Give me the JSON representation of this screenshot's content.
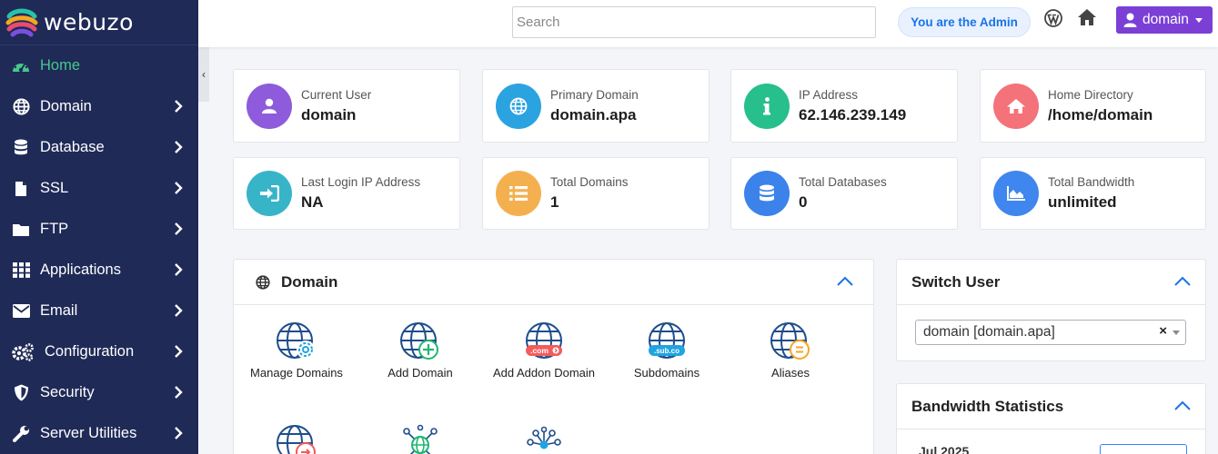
{
  "brand": {
    "name": "webuzo"
  },
  "sidebar": {
    "items": [
      {
        "label": "Home",
        "icon": "dashboard-icon",
        "active": true
      },
      {
        "label": "Domain",
        "icon": "globe-icon"
      },
      {
        "label": "Database",
        "icon": "database-icon"
      },
      {
        "label": "SSL",
        "icon": "file-icon"
      },
      {
        "label": "FTP",
        "icon": "folder-icon"
      },
      {
        "label": "Applications",
        "icon": "grid-icon"
      },
      {
        "label": "Email",
        "icon": "envelope-icon"
      },
      {
        "label": "Configuration",
        "icon": "gears-icon"
      },
      {
        "label": "Security",
        "icon": "shield-icon"
      },
      {
        "label": "Server Utilities",
        "icon": "wrench-icon"
      }
    ],
    "collapse_glyph": "‹"
  },
  "header": {
    "search_placeholder": "Search",
    "admin_badge": "You are the Admin",
    "user_menu": "domain"
  },
  "stats": [
    {
      "label": "Current User",
      "value": "domain",
      "icon": "user-icon",
      "color": "#8e5bdc"
    },
    {
      "label": "Primary Domain",
      "value": "domain.apa",
      "icon": "globe-icon",
      "color": "#2ba3e0"
    },
    {
      "label": "IP Address",
      "value": "62.146.239.149",
      "icon": "info-icon",
      "color": "#27bf8c"
    },
    {
      "label": "Home Directory",
      "value": "/home/domain",
      "icon": "home-icon",
      "color": "#f47279"
    },
    {
      "label": "Last Login IP Address",
      "value": "NA",
      "icon": "sign-in-icon",
      "color": "#38b4c8"
    },
    {
      "label": "Total Domains",
      "value": "1",
      "icon": "list-icon",
      "color": "#f4b04f"
    },
    {
      "label": "Total Databases",
      "value": "0",
      "icon": "database-icon",
      "color": "#3b82ea"
    },
    {
      "label": "Total Bandwidth",
      "value": "unlimited",
      "icon": "area-chart-icon",
      "color": "#3f86ee"
    }
  ],
  "domain_panel": {
    "title": "Domain",
    "apps": [
      {
        "label": "Manage Domains",
        "icon": "manage-domains-icon"
      },
      {
        "label": "Add Domain",
        "icon": "add-domain-icon"
      },
      {
        "label": "Add Addon Domain",
        "icon": "addon-domain-icon",
        "badge": ".com"
      },
      {
        "label": "Subdomains",
        "icon": "subdomains-icon",
        "badge": ".sub.co"
      },
      {
        "label": "Aliases",
        "icon": "aliases-icon"
      }
    ]
  },
  "switch_user": {
    "title": "Switch User",
    "selected": "domain [domain.apa]",
    "clear_glyph": "×"
  },
  "bandwidth": {
    "title": "Bandwidth Statistics",
    "month": "Jul 2025"
  },
  "colors": {
    "sidebar_bg": "#1f2a57",
    "active": "#46c98c",
    "accent": "#1a73e8",
    "user_button": "#7b3fd6"
  }
}
